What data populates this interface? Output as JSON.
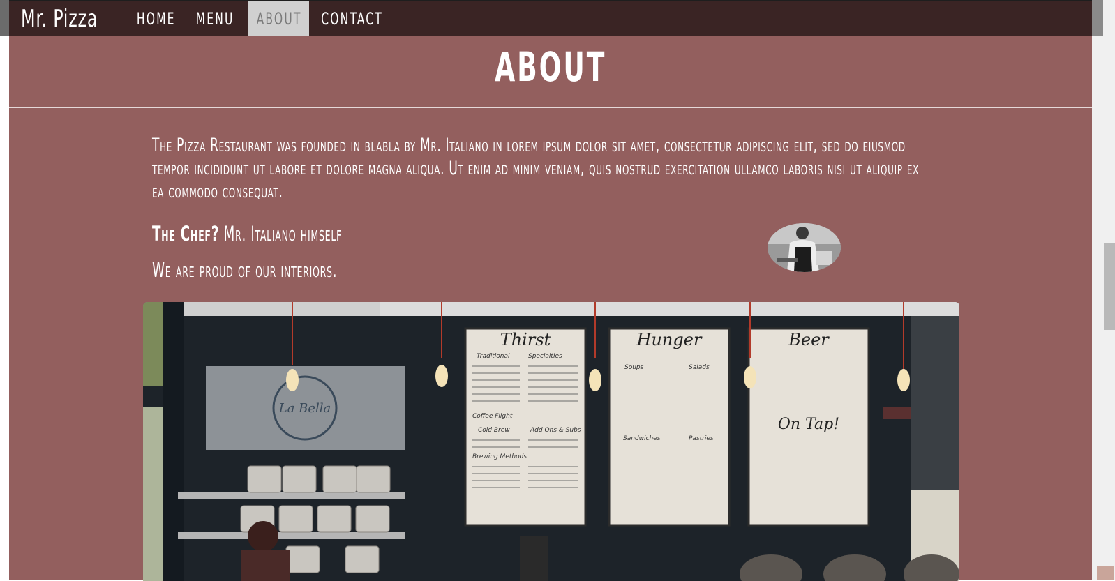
{
  "nav": {
    "brand": "Mr. Pizza",
    "items": [
      {
        "label": "HOME"
      },
      {
        "label": "MENU"
      },
      {
        "label": "ABOUT",
        "active": true
      },
      {
        "label": "CONTACT"
      }
    ]
  },
  "about": {
    "title": "ABOUT",
    "paragraph": "The Pizza Restaurant was founded in blabla by Mr. Italiano in lorem ipsum dolor sit amet, consectetur adipiscing elit, sed do eiusmod tempor incididunt ut labore et dolore magna aliqua. Ut enim ad minim veniam, quis nostrud exercitation ullamco laboris nisi ut aliquip ex ea commodo consequat.",
    "chef_label": "The Chef?",
    "chef_name": "Mr. Italiano himself",
    "interiors": "We are proud of our interiors."
  },
  "colors": {
    "navbar": "#3a2424",
    "page_background": "#935f5e",
    "active_tab": "#d0d0d0"
  },
  "hero_image": {
    "menu_boards": [
      "Thirst",
      "Hunger",
      "Beer"
    ],
    "board_sections": {
      "thirst": [
        "Traditional",
        "Specialties",
        "Coffee Flight",
        "Cold Brew",
        "Add Ons & Subs",
        "Brewing Methods"
      ],
      "hunger": [
        "Soups",
        "Salads",
        "Sandwiches",
        "Pastries"
      ],
      "beer": [
        "On Tap!"
      ]
    },
    "sign": "La Bella"
  }
}
